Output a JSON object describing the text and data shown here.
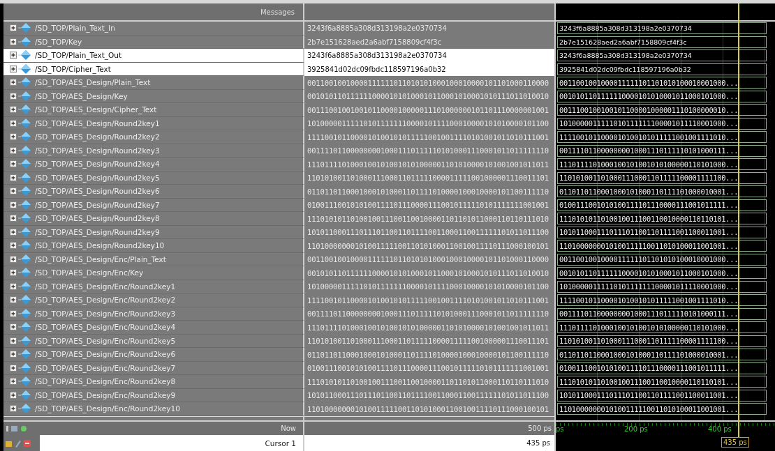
{
  "header": {
    "names": "Messages"
  },
  "signals": [
    {
      "name": "/SD_TOP/Plain_Text_In",
      "kind": "hex",
      "selected": false,
      "value": "3243f6a8885a308d313198a2e0370734",
      "wave": "3243f6a8885a308d313198a2e0370734"
    },
    {
      "name": "/SD_TOP/Key",
      "kind": "hex",
      "selected": false,
      "value": "2b7e151628aed2a6abf7158809cf4f3c",
      "wave": "2b7e151628aed2a6abf7158809cf4f3c"
    },
    {
      "name": "/SD_TOP/Plain_Text_Out",
      "kind": "hex",
      "selected": true,
      "value": "3243f6a8885a308d313198a2e0370734",
      "wave": "3243f6a8885a308d313198a2e0370734"
    },
    {
      "name": "/SD_TOP/Cipher_Text",
      "kind": "hex",
      "selected": true,
      "value": "3925841d02dc09fbdc118597196a0b32",
      "wave": "3925841d02dc09fbdc118597196a0b32"
    },
    {
      "name": "/SD_TOP/AES_Design/Plain_Text",
      "kind": "bin",
      "selected": false,
      "value": "00110010010000111111011010101000100010000101101000110000",
      "wave": "0011001001000011111101101010100010001000..."
    },
    {
      "name": "/SD_TOP/AES_Design/Key",
      "kind": "bin",
      "selected": false,
      "value": "00101011011111100001010100010110001010001010111011010010",
      "wave": "0010101101111110000101010001011000101000..."
    },
    {
      "name": "/SD_TOP/AES_Design/Cipher_Text",
      "kind": "bin",
      "selected": false,
      "value": "00111001001001011000010000011101000000101101110000001001",
      "wave": "0011100100100101100001000001110100000010..."
    },
    {
      "name": "/SD_TOP/AES_Design/Round2key1",
      "kind": "bin",
      "selected": false,
      "value": "10100000111110101111111000010111100010000101010000101100",
      "wave": "1010000011111010111111100001011110001000..."
    },
    {
      "name": "/SD_TOP/AES_Design/Round2key2",
      "kind": "bin",
      "selected": false,
      "value": "11110010110000101001010111110010011110101001011010111001",
      "wave": "1111001011000010100101011111001001111010..."
    },
    {
      "name": "/SD_TOP/AES_Design/Round2key3",
      "kind": "bin",
      "selected": false,
      "value": "00111101100000000100011101111101010001110001011011111110",
      "wave": "0011110110000000010001110111110101000111..."
    },
    {
      "name": "/SD_TOP/AES_Design/Round2key4",
      "kind": "bin",
      "selected": false,
      "value": "11101111010001001010010101000001101010000101001001011011",
      "wave": "1110111101000100101001010100000110101000..."
    },
    {
      "name": "/SD_TOP/AES_Design/Round2key5",
      "kind": "bin",
      "selected": false,
      "value": "11010100110100011100011011111000011111001000001110011101",
      "wave": "1101010011010001110001101111100001111100..."
    },
    {
      "name": "/SD_TOP/AES_Design/Round2key6",
      "kind": "bin",
      "selected": false,
      "value": "01101101100010001010001101111010000100010000101100111110",
      "wave": "0110110110001000101000110111101000010001..."
    },
    {
      "name": "/SD_TOP/AES_Design/Round2key7",
      "kind": "bin",
      "selected": false,
      "value": "01001110010101001111011100001110010111110101111111001001",
      "wave": "0100111001010100111101110000111001011111..."
    },
    {
      "name": "/SD_TOP/AES_Design/Round2key8",
      "kind": "bin",
      "selected": false,
      "value": "11101010110100100111001100100001101101011000110110111010",
      "wave": "1110101011010010011100110010000110110101..."
    },
    {
      "name": "/SD_TOP/AES_Design/Round2key9",
      "kind": "bin",
      "selected": false,
      "value": "10101100011101110110011011110011000110011111101011011100",
      "wave": "1010110001110111011001101111001100011001..."
    },
    {
      "name": "/SD_TOP/AES_Design/Round2key10",
      "kind": "bin",
      "selected": false,
      "value": "11010000000101001111100110101000110010011110111000100101",
      "wave": "1101000000010100111110011010100011001001..."
    },
    {
      "name": "/SD_TOP/AES_Design/Enc/Plain_Text",
      "kind": "bin",
      "selected": false,
      "value": "00110010010000111111011010101000100010000101101000110000",
      "wave": "0011001001000011111101101010100010001000..."
    },
    {
      "name": "/SD_TOP/AES_Design/Enc/Key",
      "kind": "bin",
      "selected": false,
      "value": "00101011011111100001010100010110001010001010111011010010",
      "wave": "0010101101111110000101010001011000101000..."
    },
    {
      "name": "/SD_TOP/AES_Design/Enc/Round2key1",
      "kind": "bin",
      "selected": false,
      "value": "10100000111110101111111000010111100010000101010000101100",
      "wave": "1010000011111010111111100001011110001000..."
    },
    {
      "name": "/SD_TOP/AES_Design/Enc/Round2key2",
      "kind": "bin",
      "selected": false,
      "value": "11110010110000101001010111110010011110101001011010111001",
      "wave": "1111001011000010100101011111001001111010..."
    },
    {
      "name": "/SD_TOP/AES_Design/Enc/Round2key3",
      "kind": "bin",
      "selected": false,
      "value": "00111101100000000100011101111101010001110001011011111110",
      "wave": "0011110110000000010001110111110101000111..."
    },
    {
      "name": "/SD_TOP/AES_Design/Enc/Round2key4",
      "kind": "bin",
      "selected": false,
      "value": "11101111010001001010010101000001101010000101001001011011",
      "wave": "1110111101000100101001010100000110101000..."
    },
    {
      "name": "/SD_TOP/AES_Design/Enc/Round2key5",
      "kind": "bin",
      "selected": false,
      "value": "11010100110100011100011011111000011111001000001110011101",
      "wave": "1101010011010001110001101111100001111100..."
    },
    {
      "name": "/SD_TOP/AES_Design/Enc/Round2key6",
      "kind": "bin",
      "selected": false,
      "value": "01101101100010001010001101111010000100010000101100111110",
      "wave": "0110110110001000101000110111101000010001..."
    },
    {
      "name": "/SD_TOP/AES_Design/Enc/Round2key7",
      "kind": "bin",
      "selected": false,
      "value": "01001110010101001111011100001110010111110101111111001001",
      "wave": "0100111001010100111101110000111001011111..."
    },
    {
      "name": "/SD_TOP/AES_Design/Enc/Round2key8",
      "kind": "bin",
      "selected": false,
      "value": "11101010110100100111001100100001101101011000110110111010",
      "wave": "1110101011010010011100110010000110110101..."
    },
    {
      "name": "/SD_TOP/AES_Design/Enc/Round2key9",
      "kind": "bin",
      "selected": false,
      "value": "10101100011101110110011011110011000110011111101011011100",
      "wave": "1010110001110111011001101111001100011001..."
    },
    {
      "name": "/SD_TOP/AES_Design/Enc/Round2key10",
      "kind": "bin",
      "selected": false,
      "value": "11010000000101001111100110101000110010011110111000100101",
      "wave": "1101000000010100111110011010100011001001..."
    }
  ],
  "now": {
    "label": "Now",
    "value": "500 ps"
  },
  "timeline": {
    "labels": [
      "ps",
      "200 ps",
      "400 ps"
    ]
  },
  "cursor": {
    "label": "Cursor 1",
    "value": "435 ps",
    "marker": "435 ps"
  }
}
